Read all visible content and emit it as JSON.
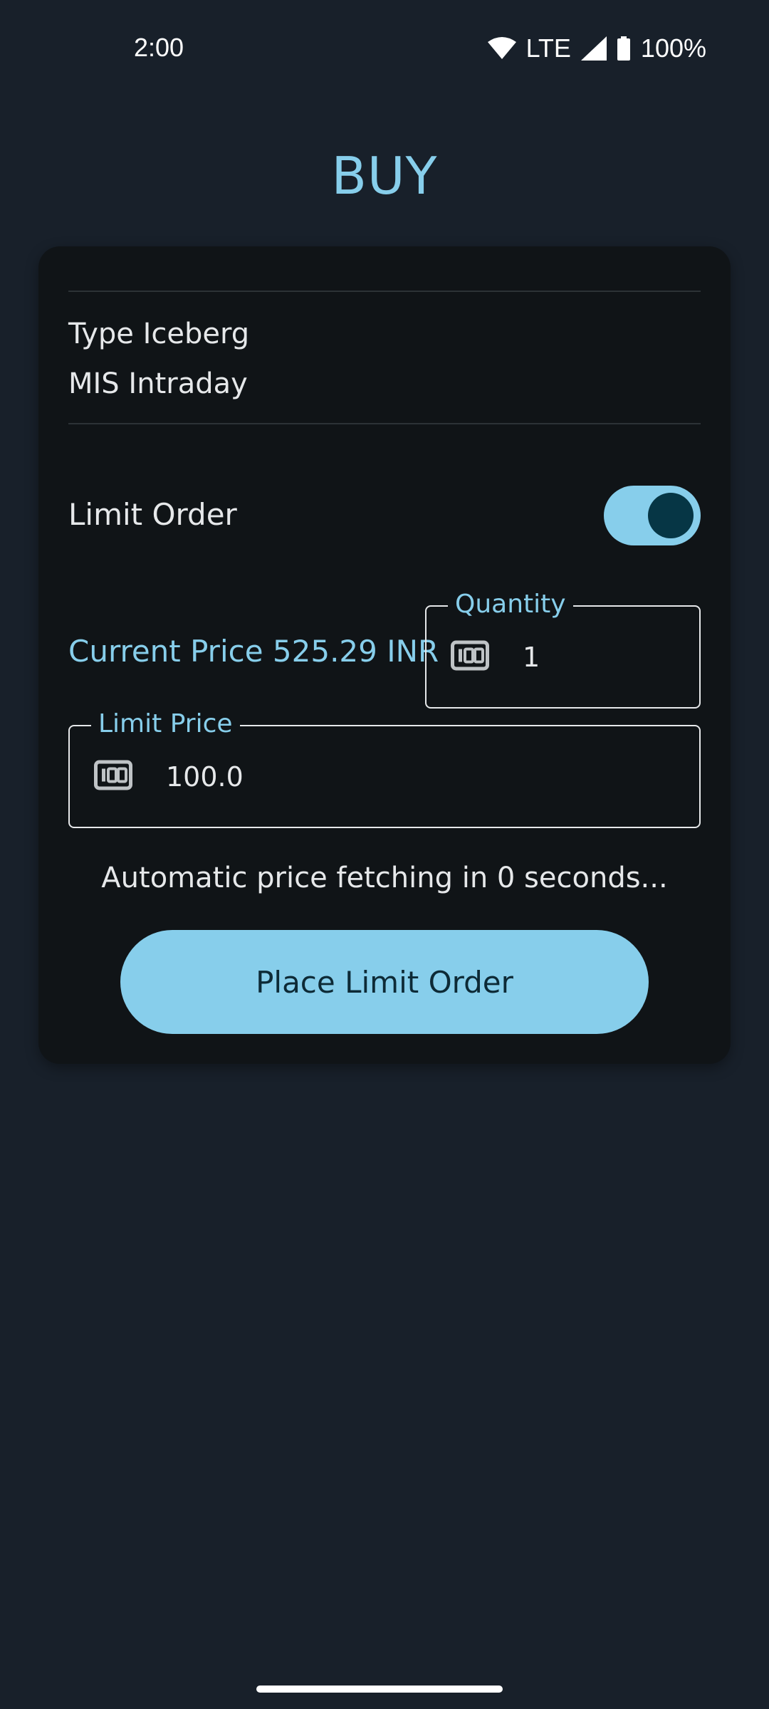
{
  "status_bar": {
    "time": "2:00",
    "network": "LTE",
    "battery": "100%"
  },
  "page": {
    "title": "BUY"
  },
  "order": {
    "type_text": "Type Iceberg",
    "product_text": "MIS Intraday",
    "limit_order_label": "Limit Order",
    "limit_order_enabled": true,
    "current_price_text": "Current Price 525.29 INR",
    "quantity": {
      "label": "Quantity",
      "value": "1",
      "icon": "number-pad-icon"
    },
    "limit_price": {
      "label": "Limit Price",
      "value": "100.0",
      "icon": "number-pad-icon"
    },
    "auto_fetch_text": "Automatic price fetching in 0 seconds...",
    "place_button_label": "Place Limit Order"
  },
  "colors": {
    "background": "#18202a",
    "card": "#101417",
    "accent": "#87ceeb",
    "toggle_thumb": "#063645"
  }
}
